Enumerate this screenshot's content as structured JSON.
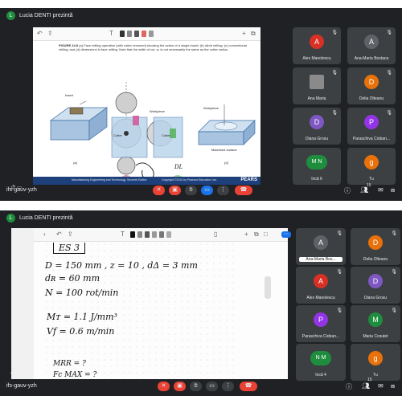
{
  "screen1": {
    "presenter_initial": "L",
    "presenter_text": "Lucia DENTI prezintă",
    "pdf": {
      "figure_label": "FIGURE 24.8",
      "caption": "(a) Face milling operation (with cutter removed) showing the action of a single insert; (b) climb milling; (c) conventional milling; and (d) dimensions in face milling. Note that the width of cut, w, is not necessarily the same as the cutter radius.",
      "labels": {
        "insert": "Insert",
        "workpiece_c": "Workpiece",
        "workpiece_d": "Workpiece",
        "cutter_b": "Cutter",
        "cutter_c": "Cutter",
        "machined_surface": "Machined surface",
        "a": "(a)",
        "b": "(b)",
        "c": "(c)",
        "d": "(d)",
        "dl": "DL"
      },
      "footer_left": "Manufacturing Engineering and Technology, Seventh Edition",
      "footer_copyright": "Copyright ©2014 by Pearson Education, Inc.",
      "footer_brand": "PEARS"
    },
    "participants": [
      {
        "initial": "A",
        "name": "Alex Manolescu",
        "color": "#d93025"
      },
      {
        "initial": "A",
        "name": "Ana-Maria Bostaca",
        "color": "#3c4043"
      },
      {
        "initial": "",
        "name": "Ana Maria",
        "color": "#5f6368",
        "photo": true
      },
      {
        "initial": "D",
        "name": "Delia Olteanu",
        "color": "#e8710a"
      },
      {
        "initial": "D",
        "name": "Diana Grosu",
        "color": "#7e57c2"
      },
      {
        "initial": "P",
        "name": "Paraschiva Cioban...",
        "color": "#9334e6"
      },
      {
        "initial": "M N",
        "name": "Încă 6",
        "color": "#1e8e3e",
        "pair": true
      },
      {
        "initial": "g",
        "name": "Tu",
        "color": "#e8710a",
        "self": true
      }
    ],
    "room": "ifs-gauv-yzh"
  },
  "screen2": {
    "presenter_initial": "L",
    "presenter_text": "Lucia DENTI prezintă",
    "notes": {
      "title": "ES 3",
      "line1": "D = 150 mm ,  z = 10 ,  dΔ = 3 mm",
      "line2": "dʀ = 60 mm",
      "line3": "N = 100 rot/min",
      "line4": "Mᴛ = 1.1 J/mm³",
      "line5": "Vf = 0.6 m/min",
      "line6": "MRR = ?",
      "line7": "Fc MAX = ?"
    },
    "participants": [
      {
        "initial": "A",
        "name": "Ana-Maria Bos...",
        "color": "#5f6368",
        "pin": true
      },
      {
        "initial": "D",
        "name": "Delia Olteanu",
        "color": "#e8710a"
      },
      {
        "initial": "A",
        "name": "Alex Manolescu",
        "color": "#d93025"
      },
      {
        "initial": "D",
        "name": "Diana Grosu",
        "color": "#7e57c2"
      },
      {
        "initial": "P",
        "name": "Paraschiva Cioban...",
        "color": "#9334e6"
      },
      {
        "initial": "M",
        "name": "Maria Cosutet",
        "color": "#1e8e3e"
      },
      {
        "initial": "N M",
        "name": "Încă 4",
        "color": "#1e8e3e",
        "pair": true
      },
      {
        "initial": "g",
        "name": "Tu",
        "color": "#e8710a"
      }
    ],
    "room": "ifs-gauv-yzh"
  },
  "icons": [
    "mic-off-icon",
    "camera-off-icon",
    "hand-icon",
    "present-icon",
    "more-icon",
    "hangup-icon",
    "info-icon",
    "people-icon",
    "activities-icon"
  ],
  "counts": {
    "people_badge_1": "15",
    "people_badge_2": "15"
  }
}
